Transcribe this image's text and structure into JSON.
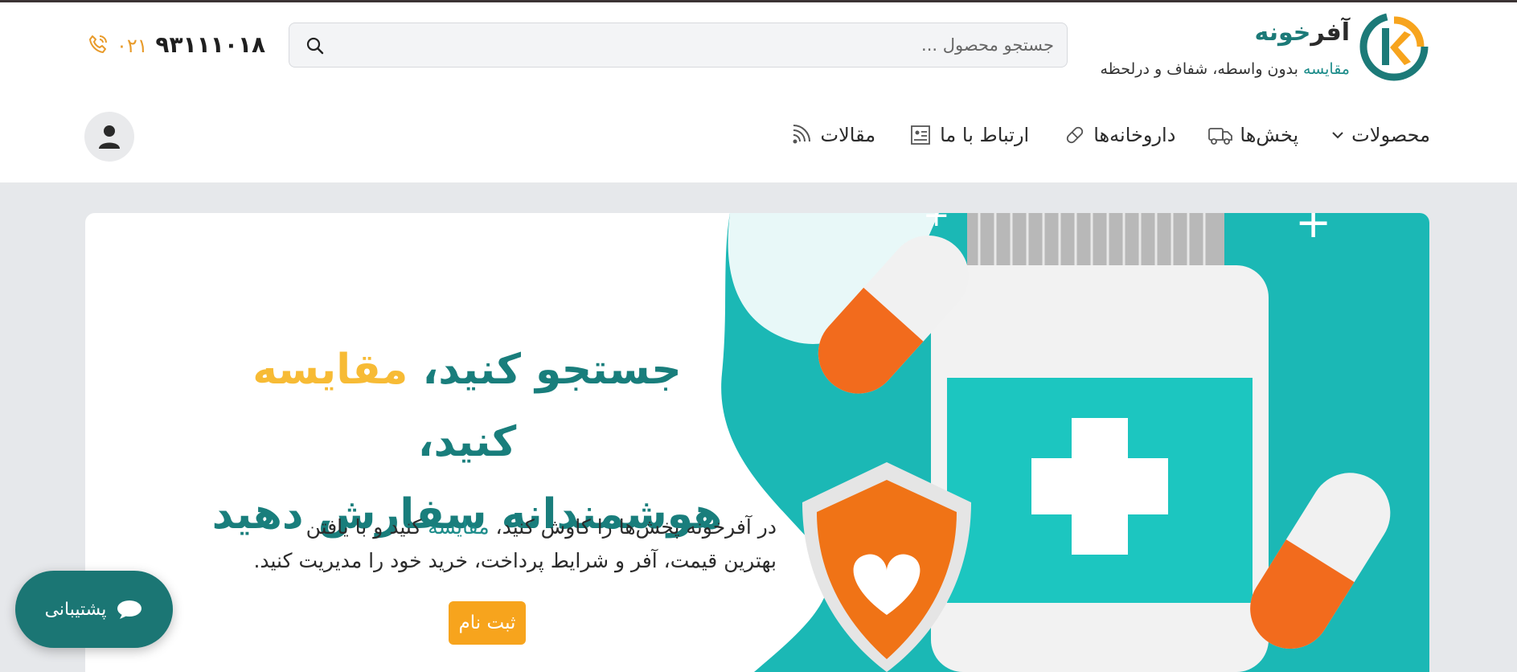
{
  "brand": {
    "name_part1": "آفر",
    "name_part2": "خونه",
    "tagline_accent": "مقایسه",
    "tagline_rest": " بدون واسطه، شفاف و درلحظه",
    "colors": {
      "teal": "#1c7a78",
      "orange": "#f7a41d",
      "yellow": "#f7bb35"
    }
  },
  "search": {
    "placeholder": "جستجو محصول ..."
  },
  "contact": {
    "phone_main": "۹۳۱۱۱۰۱۸",
    "phone_code": "۰۲۱"
  },
  "nav": {
    "items": [
      {
        "label": "محصولات",
        "icon": "chevron-down-icon"
      },
      {
        "label": "پخش‌ها",
        "icon": "truck-icon"
      },
      {
        "label": "داروخانه‌ها",
        "icon": "pill-icon"
      },
      {
        "label": "ارتباط با ما",
        "icon": "contact-card-icon"
      },
      {
        "label": "مقالات",
        "icon": "rss-icon"
      }
    ]
  },
  "hero": {
    "line1_a": "جستجو کنید، ",
    "line1_b": "مقایسه",
    "line1_c": " کنید،",
    "line2": "هوشمندانه سفارش دهید",
    "desc_a": "در آفرخونه پخش‌ها را کاوش کنید، ",
    "desc_b": "مقایسه",
    "desc_c": " کنید و با یافتن",
    "desc_line2": "بهترین قیمت، آفر و شرایط پرداخت، خرید خود را مدیریت کنید.",
    "cta_label": "ثبت نام"
  },
  "support": {
    "label": "پشتیبانی"
  }
}
